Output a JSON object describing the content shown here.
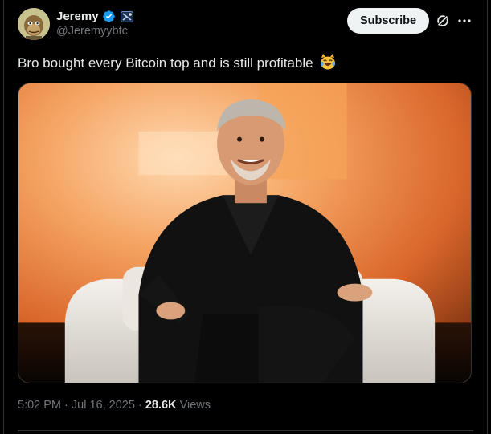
{
  "author": {
    "display_name": "Jeremy",
    "handle": "@Jeremyybtc",
    "avatar": "bored-ape-avatar",
    "badges": [
      "verified-icon",
      "affiliate-icon"
    ]
  },
  "actions": {
    "subscribe_label": "Subscribe",
    "icons": [
      "grok-icon",
      "more-icon"
    ]
  },
  "tweet": {
    "text": "Bro bought every Bitcoin top and is still profitable",
    "emoji": "laughing-tears-cat-emoji",
    "media": "photo-man-seated-in-white-armchair-orange-background"
  },
  "meta": {
    "time": "5:02 PM",
    "separator_1": "·",
    "date": "Jul 16, 2025",
    "separator_2": "·",
    "views_count": "28.6K",
    "views_label": "Views"
  },
  "colors": {
    "background": "#000000",
    "text_primary": "#e7e9ea",
    "text_secondary": "#71767b",
    "verified_blue": "#1d9bf0",
    "button_bg": "#eff3f4"
  }
}
